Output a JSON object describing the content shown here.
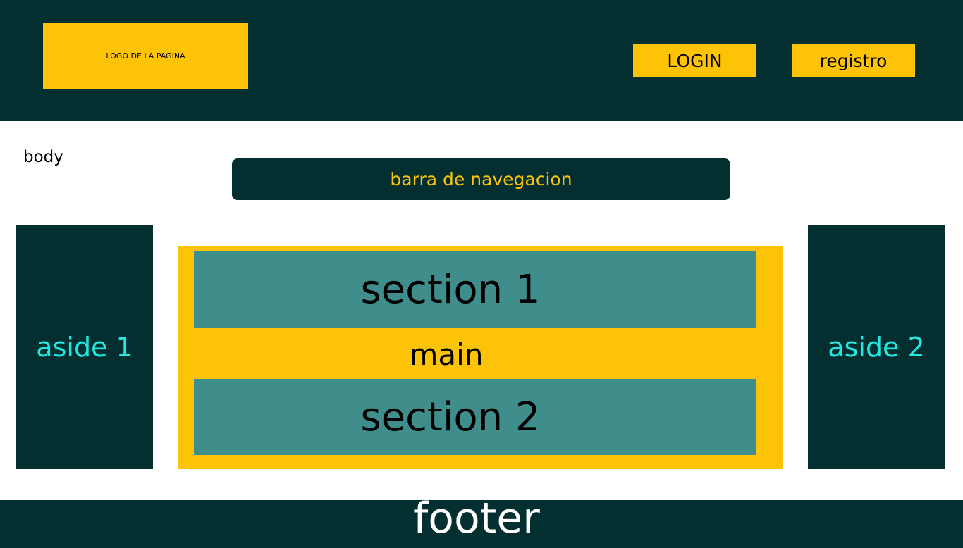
{
  "colors": {
    "dark": "#032f31",
    "accent_yellow": "#fdc307",
    "teal": "#3f8e8c",
    "cyan_text": "#22e8e0",
    "white": "#ffffff"
  },
  "header": {
    "logo_text": "LOGO  DE LA PAGINA",
    "login_label": "LOGIN",
    "registro_label": "registro"
  },
  "body_label": "body",
  "navbar": {
    "label": "barra de navegacion"
  },
  "asides": {
    "left": "aside 1",
    "right": "aside 2"
  },
  "main": {
    "label": "main",
    "section_1": "section 1",
    "section_2": "section 2"
  },
  "footer": {
    "label": "footer"
  }
}
